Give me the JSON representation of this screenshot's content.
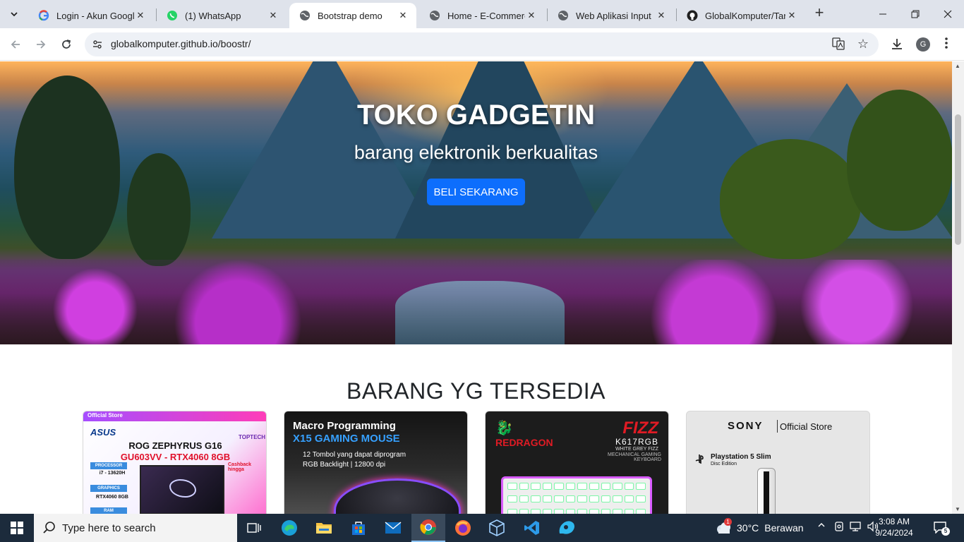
{
  "browser": {
    "tabs": [
      {
        "title": "Login - Akun Google",
        "icon": "google-icon"
      },
      {
        "title": "(1) WhatsApp",
        "icon": "whatsapp-icon"
      },
      {
        "title": "Bootstrap demo",
        "icon": "globe-icon",
        "active": true
      },
      {
        "title": "Home - E-Commerce",
        "icon": "globe-icon"
      },
      {
        "title": "Web Aplikasi Input",
        "icon": "globe-icon"
      },
      {
        "title": "GlobalKomputer/Tam",
        "icon": "github-icon"
      }
    ],
    "url": "globalkomputer.github.io/boostr/",
    "profile_initial": "G"
  },
  "hero": {
    "title": "TOKO GADGETIN",
    "subtitle": "barang elektronik berkualitas",
    "cta_label": "BELI SEKARANG",
    "cta_color": "#0d6efd"
  },
  "products_section": {
    "title": "BARANG YG TERSEDIA",
    "cards": [
      {
        "ribbon": "Official Store",
        "brand": "ASUS",
        "store": "TOPTECH",
        "line1": "ROG ZEPHYRUS G16",
        "line2": "GU603VV - RTX4060 8GB",
        "specs": [
          {
            "tag": "PROCESSOR",
            "value": "i7 - 13620H"
          },
          {
            "tag": "GRAPHICS",
            "value": "RTX4060 8GB"
          },
          {
            "tag": "RAM",
            "value": ""
          }
        ],
        "cashback": "Cashback hingga"
      },
      {
        "line1": "Macro Programming",
        "line2": "X15 GAMING MOUSE",
        "line3": "12 Tombol yang dapat diprogram",
        "line4": "RGB Backlight | 12800 dpi"
      },
      {
        "brand": "REDRAGON",
        "model_name": "FIZZ",
        "model_code": "K617RGB",
        "line1": "WHITE GREY FIZZ",
        "line2": "MECHANICAL GAMING KEYBOARD"
      },
      {
        "brand": "SONY",
        "store": "Official Store",
        "product": "Playstation 5 Slim",
        "edition": "Disc Edition"
      }
    ]
  },
  "taskbar": {
    "search_placeholder": "Type here to search",
    "weather_temp": "30°C",
    "weather_desc": "Berawan",
    "weather_badge": "1",
    "time": "3:08 AM",
    "date": "9/24/2024",
    "notification_count": "5"
  }
}
